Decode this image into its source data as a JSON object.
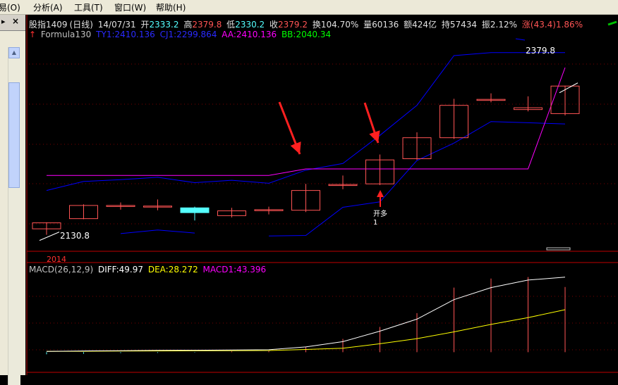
{
  "menu": [
    "易(O)",
    "分析(A)",
    "工具(T)",
    "窗口(W)",
    "帮助(H)"
  ],
  "header": {
    "name": "股指1409",
    "period": "(日线)",
    "date": "14/07/31",
    "open_label": "开",
    "open_value": "2333.2",
    "high_label": "高",
    "high_value": "2379.8",
    "low_label": "低",
    "low_value": "2330.2",
    "close_label": "收",
    "close_value": "2379.2",
    "turnover_label": "换",
    "turnover_value": "104.70%",
    "volume_label": "量",
    "volume_value": "60136",
    "amount_label": "额",
    "amount_value": "424亿",
    "hold_label": "持",
    "hold_value": "57434",
    "amplitude_label": "振",
    "amplitude_value": "2.12%",
    "change_label": "涨",
    "change_value": "(43.4)1.86%"
  },
  "formula": {
    "name": "Formula130",
    "ty1": "TY1:2410.136",
    "cj1": "CJ1:2299.864",
    "aa": "AA:2410.136",
    "bb": "BB:2040.34"
  },
  "annotations": {
    "high_price": "2379.8",
    "low_price": "2130.8",
    "signal": "开多",
    "signal_count": "1",
    "year": "2014"
  },
  "macd": {
    "label": "MACD(26,12,9)",
    "diff": "DIFF:49.97",
    "dea": "DEA:28.272",
    "macd1": "MACD1:43.396"
  },
  "colors": {
    "background": "#000000",
    "up": "#ff5454",
    "down": "#54ffff",
    "ty1": "#0000ff",
    "aa": "#ff00ff",
    "bb": "#00ff00",
    "diff": "#ffffff",
    "dea": "#ffff00",
    "frame": "#c00000"
  },
  "candles": [
    {
      "o": 2141,
      "h": 2152,
      "l": 2131,
      "c": 2151
    },
    {
      "o": 2158,
      "h": 2182,
      "l": 2157,
      "c": 2180
    },
    {
      "o": 2180,
      "h": 2185,
      "l": 2173,
      "c": 2180
    },
    {
      "o": 2179,
      "h": 2190,
      "l": 2172,
      "c": 2179
    },
    {
      "o": 2176,
      "h": 2178,
      "l": 2155,
      "c": 2168
    },
    {
      "o": 2163,
      "h": 2176,
      "l": 2160,
      "c": 2171
    },
    {
      "o": 2173,
      "h": 2178,
      "l": 2165,
      "c": 2173
    },
    {
      "o": 2172,
      "h": 2216,
      "l": 2169,
      "c": 2205
    },
    {
      "o": 2214,
      "h": 2230,
      "l": 2207,
      "c": 2215
    },
    {
      "o": 2216,
      "h": 2265,
      "l": 2214,
      "c": 2256
    },
    {
      "o": 2258,
      "h": 2302,
      "l": 2256,
      "c": 2293
    },
    {
      "o": 2293,
      "h": 2358,
      "l": 2291,
      "c": 2347
    },
    {
      "o": 2357,
      "h": 2367,
      "l": 2352,
      "c": 2357
    },
    {
      "o": 2340,
      "h": 2362,
      "l": 2337,
      "c": 2343
    },
    {
      "o": 2333.2,
      "h": 2379.8,
      "l": 2330.2,
      "c": 2379.2
    }
  ],
  "ty1_line": [
    2205,
    2220,
    2223,
    2227,
    2218,
    2222,
    2217,
    2239,
    2250,
    2297,
    2347,
    2430,
    2435,
    2435,
    2435
  ],
  "cj1_line": [
    null,
    null,
    2133,
    2139,
    2134,
    null,
    2129,
    2130,
    2177,
    2186,
    2255,
    2284,
    2320,
    2318,
    2316
  ],
  "aa_line": [
    2230,
    2230,
    2230,
    2230,
    2230,
    2230,
    2230,
    2241,
    2241,
    2241,
    2241,
    2241,
    2241,
    2241,
    2410
  ],
  "macd_diff": [
    0.5,
    0.8,
    1.0,
    1.2,
    1.3,
    1.4,
    1.6,
    3.5,
    7.0,
    14.0,
    22.0,
    35.0,
    43.0,
    48.0,
    49.97
  ],
  "macd_dea": [
    0.5,
    0.6,
    0.7,
    0.8,
    0.9,
    1.0,
    1.1,
    1.8,
    2.6,
    5.6,
    9.0,
    13.5,
    18.5,
    23.0,
    28.272
  ],
  "macd_bar": [
    -1.4,
    -1.1,
    -0.6,
    -0.5,
    -0.3,
    0.5,
    0.7,
    3.4,
    8.8,
    16.8,
    26.0,
    43.0,
    49.0,
    50.0,
    43.396
  ]
}
